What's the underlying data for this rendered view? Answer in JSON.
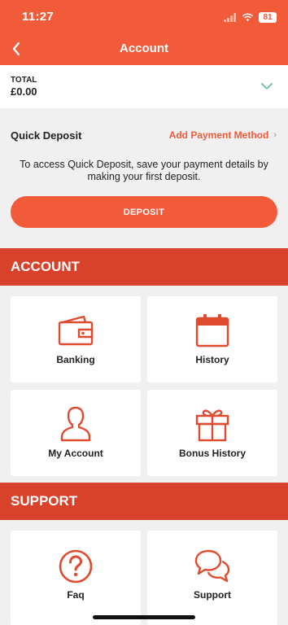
{
  "status_bar": {
    "time": "11:27",
    "battery": "81"
  },
  "nav": {
    "title": "Account"
  },
  "balance": {
    "label": "TOTAL",
    "value": "£0.00"
  },
  "quick_deposit": {
    "title": "Quick Deposit",
    "link": "Add Payment Method",
    "message": "To access Quick Deposit, save your payment details by making your first deposit.",
    "button": "DEPOSIT"
  },
  "account_section": {
    "title": "ACCOUNT",
    "items": [
      {
        "label": "Banking",
        "icon": "wallet-icon"
      },
      {
        "label": "History",
        "icon": "calendar-icon"
      },
      {
        "label": "My Account",
        "icon": "user-icon"
      },
      {
        "label": "Bonus History",
        "icon": "gift-icon"
      }
    ]
  },
  "support_section": {
    "title": "SUPPORT",
    "items": [
      {
        "label": "Faq",
        "icon": "question-icon"
      },
      {
        "label": "Support",
        "icon": "chat-icon"
      }
    ]
  },
  "colors": {
    "brand": "#f25b3a",
    "section": "#d8412a",
    "background": "#f0f0f0",
    "accent_green": "#7fc8a9"
  }
}
